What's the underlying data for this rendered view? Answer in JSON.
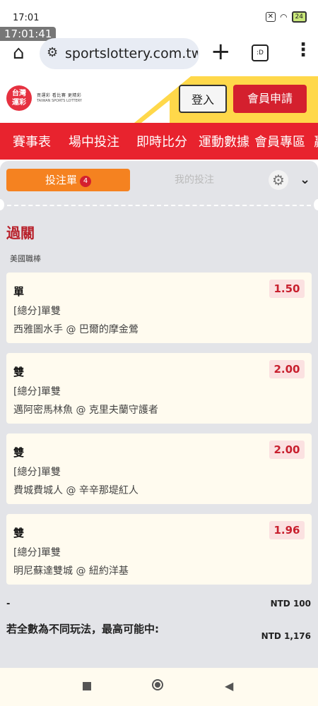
{
  "status": {
    "time": "17:01",
    "overlay_time": "17:01:41",
    "battery": "24"
  },
  "browser": {
    "url": "sportslottery.com.tw/s"
  },
  "site": {
    "logo_text_1": "台灣",
    "logo_text_2": "運彩",
    "logo_tagline": "買運彩 看比賽 更精彩",
    "logo_subtitle": "TAIWAN SPORTS LOTTERY",
    "login_label": "登入",
    "join_label": "會員申請"
  },
  "nav": {
    "items": [
      "賽事表",
      "場中投注",
      "即時比分",
      "運動數據",
      "會員專區",
      "贏"
    ]
  },
  "betslip": {
    "tab_active": "投注單",
    "tab_badge": "4",
    "tab_inactive": "我的投注",
    "section_title": "過關",
    "league": "美國職棒",
    "bets": [
      {
        "pick": "單",
        "odds": "1.50",
        "market": "[總分]單雙",
        "match": "西雅圖水手 @ 巴爾的摩金鶯"
      },
      {
        "pick": "雙",
        "odds": "2.00",
        "market": "[總分]單雙",
        "match": "邁阿密馬林魚 @ 克里夫蘭守護者"
      },
      {
        "pick": "雙",
        "odds": "2.00",
        "market": "[總分]單雙",
        "match": "費城費城人 @ 辛辛那堤紅人"
      },
      {
        "pick": "雙",
        "odds": "1.96",
        "market": "[總分]單雙",
        "match": "明尼蘇達雙城 @ 紐約洋基"
      }
    ],
    "summary_dash": "-",
    "stake": "NTD 100",
    "payout_label": "若全數為不同玩法，最高可能中:",
    "payout_value": "NTD 1,176"
  },
  "colors": {
    "accent_red": "#e8232e",
    "tab_orange": "#f58220",
    "odds_red": "#c8202e"
  }
}
